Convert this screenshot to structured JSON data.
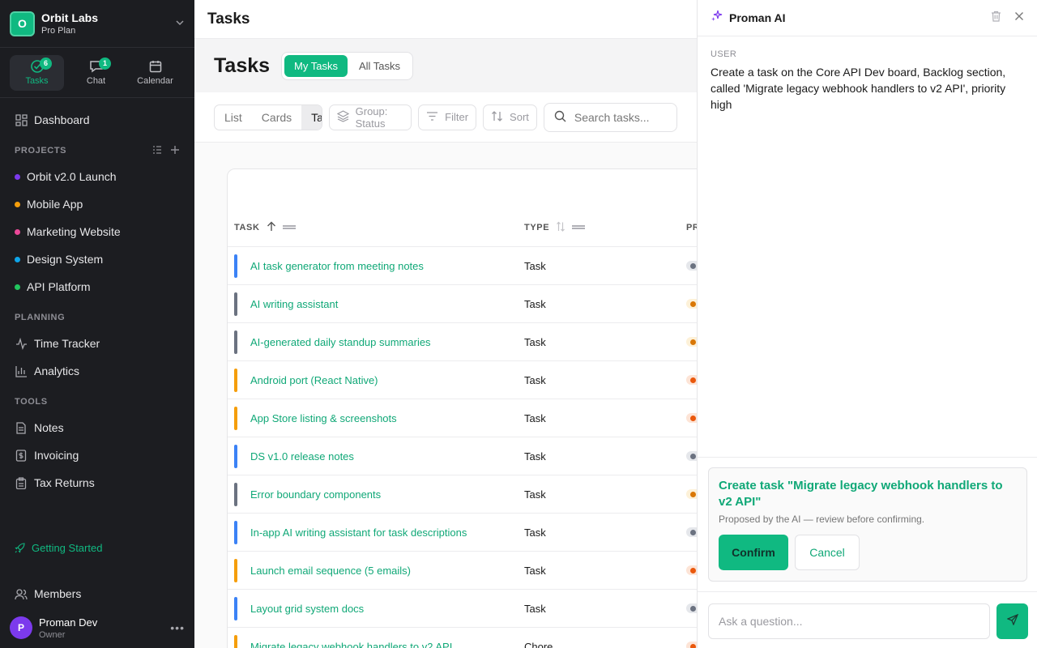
{
  "workspace": {
    "initial": "O",
    "name": "Orbit Labs",
    "plan": "Pro Plan"
  },
  "topnav": [
    {
      "label": "Tasks",
      "badge": "6",
      "icon": "tasks-icon"
    },
    {
      "label": "Chat",
      "badge": "1",
      "icon": "chat-icon"
    },
    {
      "label": "Calendar",
      "badge": "",
      "icon": "calendar-icon"
    }
  ],
  "nav": {
    "dashboard": "Dashboard"
  },
  "projects": {
    "label": "PROJECTS",
    "items": [
      {
        "name": "Orbit v2.0 Launch",
        "color": "#7c3aed"
      },
      {
        "name": "Mobile App",
        "color": "#f59e0b"
      },
      {
        "name": "Marketing Website",
        "color": "#ec4899"
      },
      {
        "name": "Design System",
        "color": "#0ea5e9"
      },
      {
        "name": "API Platform",
        "color": "#22c55e"
      }
    ]
  },
  "planning": {
    "label": "PLANNING",
    "time_tracker": "Time Tracker",
    "analytics": "Analytics"
  },
  "tools": {
    "label": "TOOLS",
    "notes": "Notes",
    "invoicing": "Invoicing",
    "tax_returns": "Tax Returns"
  },
  "getting_started": "Getting Started",
  "members": "Members",
  "user": {
    "initial": "P",
    "name": "Proman Dev",
    "role": "Owner"
  },
  "main": {
    "topbar_title": "Tasks",
    "title": "Tasks",
    "scope_tabs": [
      "My Tasks",
      "All Tasks"
    ],
    "views": [
      "List",
      "Cards",
      "Table"
    ],
    "group_label": "Group: Status",
    "filter_label": "Filter",
    "sort_label": "Sort",
    "search_placeholder": "Search tasks..."
  },
  "table": {
    "columns": [
      "TASK",
      "TYPE",
      "PR"
    ],
    "rows": [
      {
        "name": "AI task generator from meeting notes",
        "type": "Task",
        "bar": "#3b82f6",
        "pri_bg": "#e5e7eb",
        "pri_dot": "#6b7280"
      },
      {
        "name": "AI writing assistant",
        "type": "Task",
        "bar": "#6b7280",
        "pri_bg": "#fdf1d8",
        "pri_dot": "#d97706"
      },
      {
        "name": "AI-generated daily standup summaries",
        "type": "Task",
        "bar": "#6b7280",
        "pri_bg": "#fdf1d8",
        "pri_dot": "#d97706"
      },
      {
        "name": "Android port (React Native)",
        "type": "Task",
        "bar": "#f59e0b",
        "pri_bg": "#fde4d6",
        "pri_dot": "#ea580c"
      },
      {
        "name": "App Store listing & screenshots",
        "type": "Task",
        "bar": "#f59e0b",
        "pri_bg": "#fde4d6",
        "pri_dot": "#ea580c"
      },
      {
        "name": "DS v1.0 release notes",
        "type": "Task",
        "bar": "#3b82f6",
        "pri_bg": "#e5e7eb",
        "pri_dot": "#6b7280"
      },
      {
        "name": "Error boundary components",
        "type": "Task",
        "bar": "#6b7280",
        "pri_bg": "#fdf1d8",
        "pri_dot": "#d97706"
      },
      {
        "name": "In-app AI writing assistant for task descriptions",
        "type": "Task",
        "bar": "#3b82f6",
        "pri_bg": "#e5e7eb",
        "pri_dot": "#6b7280"
      },
      {
        "name": "Launch email sequence (5 emails)",
        "type": "Task",
        "bar": "#f59e0b",
        "pri_bg": "#fde4d6",
        "pri_dot": "#ea580c"
      },
      {
        "name": "Layout grid system docs",
        "type": "Task",
        "bar": "#3b82f6",
        "pri_bg": "#e5e7eb",
        "pri_dot": "#6b7280"
      },
      {
        "name": "Migrate legacy webhook handlers to v2 API",
        "type": "Chore",
        "bar": "#f59e0b",
        "pri_bg": "#fde4d6",
        "pri_dot": "#ea580c"
      }
    ]
  },
  "ai": {
    "title": "Proman AI",
    "message_label": "USER",
    "message_text": "Create a task on the Core API Dev board, Backlog section, called 'Migrate legacy webhook handlers to v2 API', priority high",
    "proposal_title": "Create task \"Migrate legacy webhook handlers to v2 API\"",
    "proposal_sub": "Proposed by the AI — review before confirming.",
    "confirm": "Confirm",
    "cancel": "Cancel",
    "input_placeholder": "Ask a question..."
  },
  "colors": {
    "accent": "#10b981",
    "sidebar_bg": "#1c1d21"
  }
}
